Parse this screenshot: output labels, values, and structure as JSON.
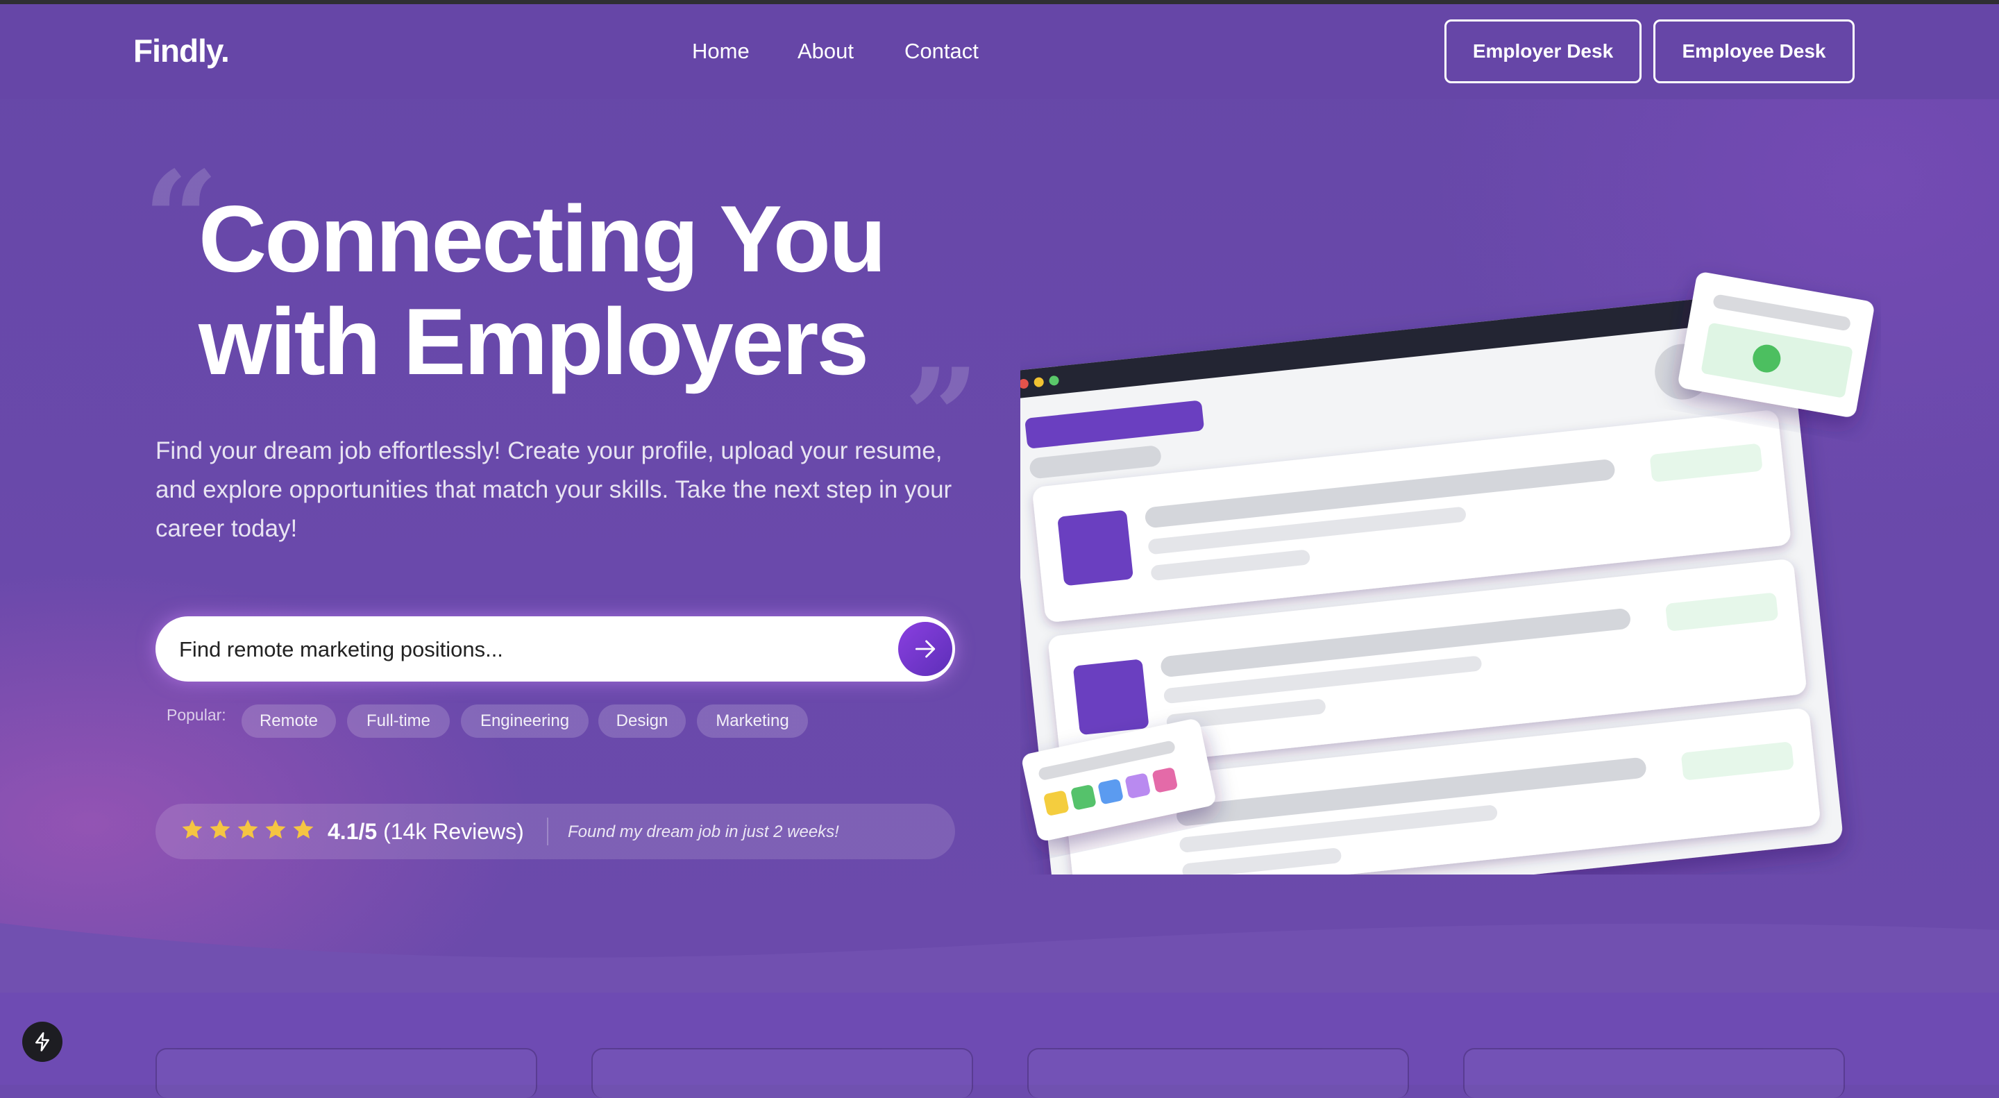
{
  "header": {
    "logo": "Findly.",
    "nav": [
      "Home",
      "About",
      "Contact"
    ],
    "buttons": {
      "employer": "Employer Desk",
      "employee": "Employee Desk"
    }
  },
  "hero": {
    "title_line1": "Connecting You",
    "title_line2": "with Employers",
    "description": "Find your dream job effortlessly! Create your profile, upload your resume, and explore opportunities that match your skills. Take the next step in your career today!",
    "search": {
      "placeholder": "Find remote marketing positions...",
      "button_icon": "arrow-right-icon"
    },
    "popular_label": "Popular:",
    "popular_tags": [
      "Remote",
      "Full-time",
      "Engineering",
      "Design",
      "Marketing"
    ],
    "rating": {
      "stars": 5,
      "score": "4.1/5",
      "reviews": "(14k Reviews)",
      "testimonial": "Found my dream job in just 2 weeks!"
    }
  },
  "colors": {
    "background": "#6b4aad",
    "accent": "#6a3fc0",
    "star": "#f5c542",
    "badge_green": "#4cbf60"
  },
  "icons": {
    "floating_button": "lightning-bolt-icon"
  }
}
